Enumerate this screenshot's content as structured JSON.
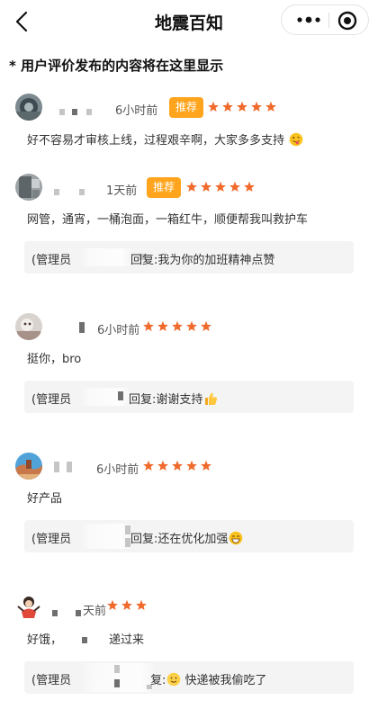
{
  "nav": {
    "title": "地震百知",
    "back_icon": "chevron-left-icon",
    "more_icon": "more-dots-icon",
    "close_icon": "target-circle-icon"
  },
  "notice": "* 用户评价发布的内容将在这里显示",
  "colors": {
    "accent": "#ffa41c",
    "star": "#f06a2c",
    "reply_bg": "#f4f4f4"
  },
  "reviews": [
    {
      "time": "6小时前",
      "badge": "推荐",
      "rating": 5,
      "content": "好不容易才审核上线，过程艰辛啊，大家多多支持",
      "content_emoji": "tongue-emoji",
      "reply": null
    },
    {
      "time": "1天前",
      "badge": "推荐",
      "rating": 5,
      "content": "网管，通宵，一桶泡面，一箱红牛，顺便帮我叫救护车",
      "reply": {
        "label": "(管理员",
        "text": "回复:我为你的加班精神点赞"
      }
    },
    {
      "time": "6小时前",
      "badge": null,
      "rating": 5,
      "content": "挺你，bro",
      "reply": {
        "label": "(管理员",
        "text": "回复:谢谢支持",
        "emoji": "thumbs-up-emoji"
      }
    },
    {
      "time": "6小时前",
      "badge": null,
      "rating": 5,
      "content": "好产品",
      "reply": {
        "label": "(管理员",
        "text": "回复:还在优化加强",
        "emoji": "grin-emoji"
      }
    },
    {
      "time": "天前",
      "badge": null,
      "rating": 3,
      "content": "好饿，",
      "content_tail": "递过来",
      "reply": {
        "label": "(管理员",
        "text": "复:",
        "emoji": "smile-emoji",
        "tail": " 快递被我偷吃了"
      }
    }
  ]
}
